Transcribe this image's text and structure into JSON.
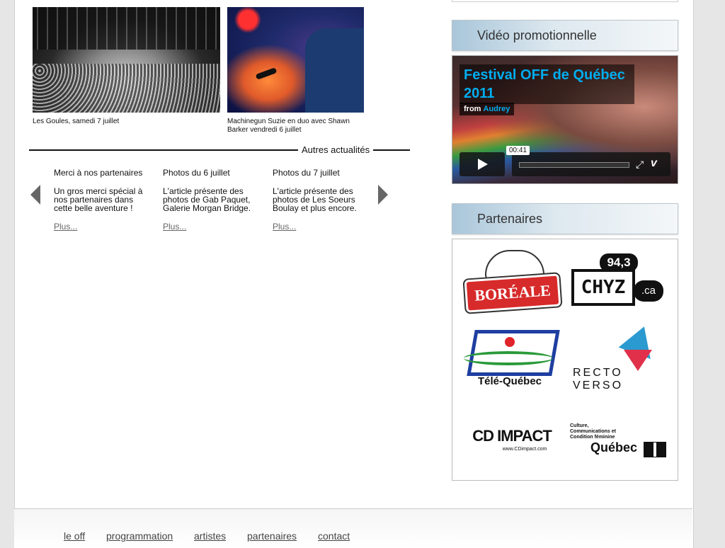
{
  "photos": [
    {
      "caption": "Les Goules, samedi 7 juillet"
    },
    {
      "caption": "Machinegun Suzie en duo avec Shawn Barker vendredi 6 juillet"
    }
  ],
  "autres_label": "Autres actualités",
  "news": [
    {
      "title": "Merci à nos partenaires",
      "body": "Un gros merci spécial à nos partenaires dans cette belle aventure !",
      "more": "Plus..."
    },
    {
      "title": "Photos du 6 juillet",
      "body": "L'article présente des photos de Gab Paquet, Galerie Morgan Bridge.",
      "more": "Plus..."
    },
    {
      "title": "Photos du 7 juillet",
      "body": "L'article présente des photos de Les Soeurs Boulay et plus encore.",
      "more": "Plus..."
    }
  ],
  "video_panel": {
    "heading": "Vidéo promotionnelle",
    "title": "Festival OFF de Québec 2011",
    "from_label": "from",
    "from_user": "Audrey",
    "time": "00:41"
  },
  "partners_panel": {
    "heading": "Partenaires",
    "logos": [
      {
        "name": "BORÉALE"
      },
      {
        "name": "CHYZ",
        "freq": "94,3",
        "tld": ".ca"
      },
      {
        "name": "Télé-Québec"
      },
      {
        "name": "RECTO VERSO"
      },
      {
        "name": "CD IMPACT",
        "sub": "www.CDimpact.com"
      },
      {
        "name": "Québec",
        "sub": "Culture, Communications et Condition féminine"
      }
    ]
  },
  "footer": {
    "links": [
      "le off",
      "programmation",
      "artistes",
      "partenaires",
      "contact"
    ]
  }
}
